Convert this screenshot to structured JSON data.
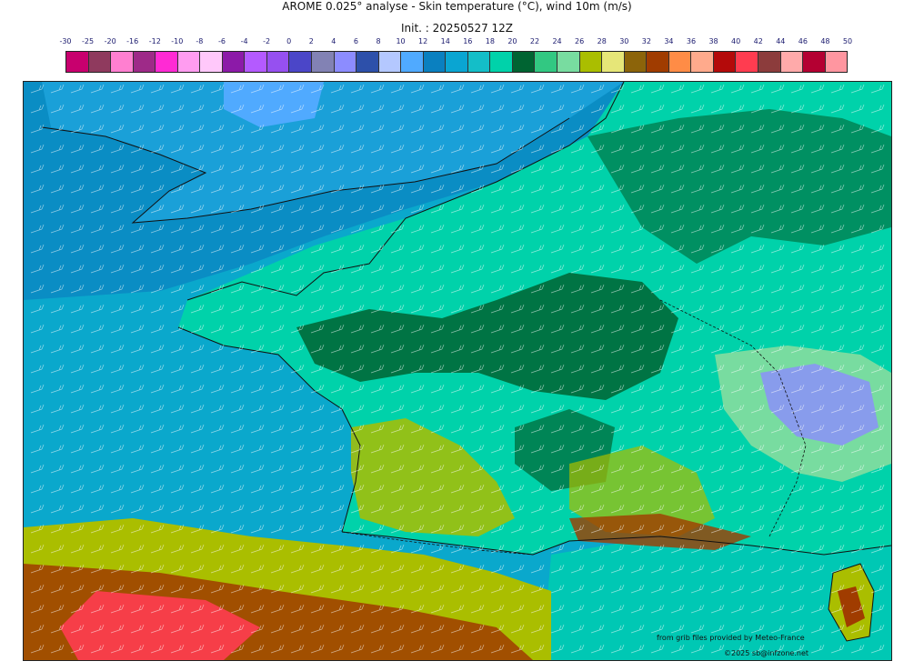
{
  "title": "AROME 0.025° analyse - Skin temperature (°C), wind 10m (m/s)",
  "subtitle": "Init. : 20250527 12Z",
  "colorbar": {
    "labels": [
      "-30",
      "-25",
      "-20",
      "-16",
      "-12",
      "-10",
      "-8",
      "-6",
      "-4",
      "-2",
      "0",
      "2",
      "4",
      "6",
      "8",
      "10",
      "12",
      "14",
      "16",
      "18",
      "20",
      "22",
      "24",
      "26",
      "28",
      "30",
      "32",
      "34",
      "36",
      "38",
      "40",
      "42",
      "44",
      "46",
      "48",
      "50"
    ],
    "colors": [
      "#c8006e",
      "#8f3a5e",
      "#ff7fd0",
      "#9e2a88",
      "#ff2ad4",
      "#ff9cf0",
      "#ffc8fa",
      "#8c1aa8",
      "#b45aff",
      "#9650f0",
      "#4b46c8",
      "#8282b4",
      "#8c8cff",
      "#2d50aa",
      "#b4c8ff",
      "#50aaff",
      "#0a80c0",
      "#0aa5d2",
      "#14bec8",
      "#00d2aa",
      "#006432",
      "#32c882",
      "#78dca0",
      "#aabe00",
      "#e6e678",
      "#8c640a",
      "#a03c00",
      "#ff8c46",
      "#ffaa8c",
      "#b40a0a",
      "#ff3c50",
      "#8c3c3c",
      "#ffaaaa",
      "#b40032",
      "#ff96a0"
    ]
  },
  "map": {
    "description_colors": {
      "sea_north": "#0a8dc4",
      "sea_atlantic": "#0aa8cc",
      "land_base": "#00d2aa",
      "land_dark": "#006432",
      "land_warm": "#aabe00",
      "land_hot": "#a03c00",
      "mountain_cold": "#8c8cff"
    }
  },
  "credits": {
    "line1": "from grib files provided by Meteo-France",
    "line2": "©2025 sb@infzone.net"
  }
}
